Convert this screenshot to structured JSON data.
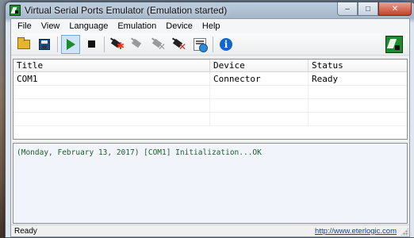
{
  "window": {
    "title": "Virtual Serial Ports Emulator (Emulation started)"
  },
  "caption_buttons": {
    "minimize": "–",
    "maximize": "□",
    "close": "✕"
  },
  "menu": {
    "items": [
      "File",
      "View",
      "Language",
      "Emulation",
      "Device",
      "Help"
    ]
  },
  "toolbar": {
    "buttons": [
      {
        "icon": "open-folder-icon"
      },
      {
        "icon": "save-icon"
      },
      {
        "icon": "start-emulation-icon",
        "pressed": true
      },
      {
        "icon": "stop-emulation-icon"
      },
      {
        "icon": "create-device-icon"
      },
      {
        "icon": "edit-device-icon",
        "disabled": true
      },
      {
        "icon": "device-plug-icon",
        "disabled": true
      },
      {
        "icon": "delete-device-icon"
      },
      {
        "icon": "settings-icon"
      },
      {
        "icon": "info-icon"
      }
    ],
    "logo_icon": "vspe-logo-icon"
  },
  "device_list": {
    "columns": [
      "Title",
      "Device",
      "Status"
    ],
    "rows": [
      {
        "title": "COM1",
        "device": "Connector",
        "status": "Ready"
      }
    ]
  },
  "log": {
    "lines": [
      "(Monday, February 13, 2017) [COM1] Initialization...OK"
    ],
    "text_color": "#1e5d2a"
  },
  "statusbar": {
    "status": "Ready",
    "link": "http://www.eterlogic.com"
  }
}
